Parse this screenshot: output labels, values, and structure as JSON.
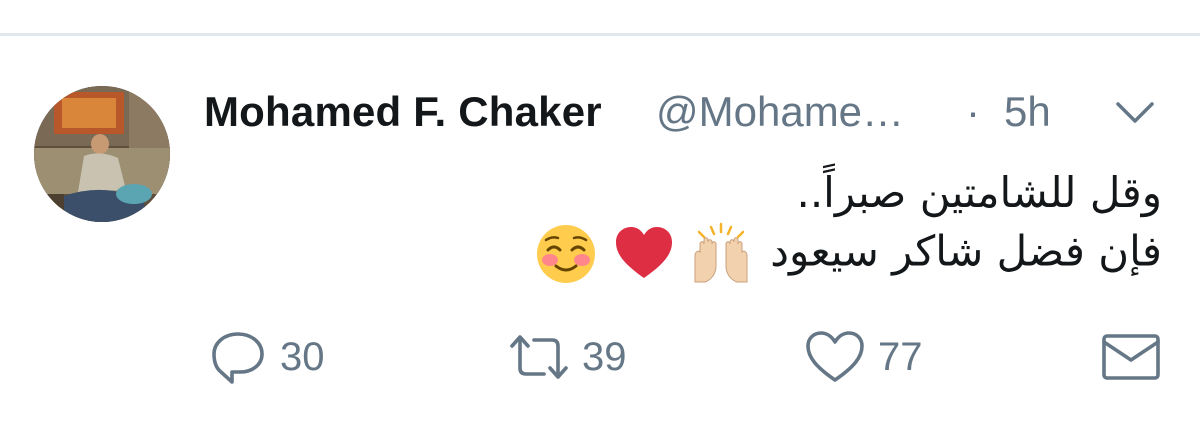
{
  "tweet": {
    "author_name": "Mohamed F. Chaker",
    "author_handle": "@Mohame…",
    "separator": "·",
    "timestamp": "5h",
    "text_line1": "وقل للشامتين صبراً..",
    "text_line2": "فإن فضل شاكر سيعود",
    "emojis": [
      "smiling-face-blush",
      "red-heart",
      "raising-hands"
    ],
    "actions": {
      "reply_count": "30",
      "retweet_count": "39",
      "like_count": "77"
    }
  },
  "colors": {
    "text_primary": "#14171a",
    "text_secondary": "#657786",
    "divider": "#e1e8ed"
  },
  "icons": {
    "caret": "chevron-down-icon",
    "reply": "reply-icon",
    "retweet": "retweet-icon",
    "like": "heart-icon",
    "dm": "envelope-icon"
  }
}
